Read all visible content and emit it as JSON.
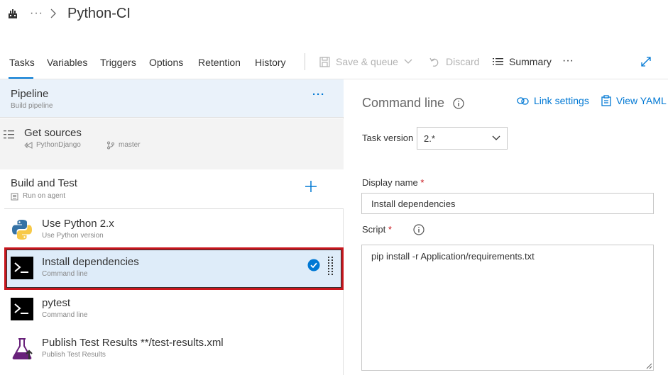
{
  "header": {
    "more": "···",
    "title": "Python-CI"
  },
  "tabs": [
    {
      "label": "Tasks",
      "active": true
    },
    {
      "label": "Variables"
    },
    {
      "label": "Triggers"
    },
    {
      "label": "Options"
    },
    {
      "label": "Retention"
    },
    {
      "label": "History"
    }
  ],
  "toolbar": {
    "save_queue": "Save & queue",
    "discard": "Discard",
    "summary": "Summary",
    "more": "···"
  },
  "pipeline": {
    "title": "Pipeline",
    "subtitle": "Build pipeline",
    "more": "···"
  },
  "sources": {
    "title": "Get sources",
    "repo": "PythonDjango",
    "branch": "master"
  },
  "job": {
    "title": "Build and Test",
    "subtitle": "Run on agent"
  },
  "tasks": [
    {
      "title": "Use Python 2.x",
      "subtitle": "Use Python version",
      "icon": "python-icon"
    },
    {
      "title": "Install dependencies",
      "subtitle": "Command line",
      "icon": "command-line-icon",
      "selected": true
    },
    {
      "title": "pytest",
      "subtitle": "Command line",
      "icon": "command-line-icon"
    },
    {
      "title": "Publish Test Results **/test-results.xml",
      "subtitle": "Publish Test Results",
      "icon": "flask-icon"
    }
  ],
  "details": {
    "title": "Command line",
    "link_settings": "Link settings",
    "view_yaml": "View YAML",
    "task_version_label": "Task version",
    "task_version": "2.*",
    "display_name_label": "Display name",
    "display_name": "Install dependencies",
    "script_label": "Script",
    "required_mark": "*",
    "script": "pip install -r Application/requirements.txt"
  },
  "colors": {
    "accent": "#0078d4",
    "selection_border": "#c8161d",
    "selected_bg": "#deecf9",
    "pipeline_bg": "#eaf2fa"
  }
}
